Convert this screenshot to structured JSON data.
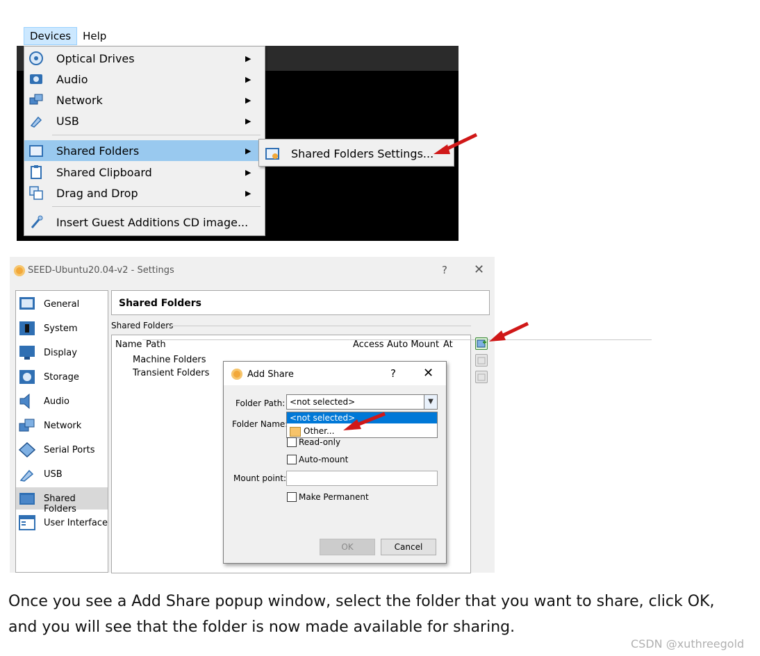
{
  "menubar": {
    "items": [
      {
        "label": "Devices"
      },
      {
        "label": "Help"
      }
    ]
  },
  "devices_menu": {
    "items": [
      {
        "label": "Optical Drives",
        "icon": "disc-icon"
      },
      {
        "label": "Audio",
        "icon": "audio-icon"
      },
      {
        "label": "Network",
        "icon": "network-icon"
      },
      {
        "label": "USB",
        "icon": "usb-icon"
      },
      {
        "label": "Shared Folders",
        "icon": "folder-icon"
      },
      {
        "label": "Shared Clipboard",
        "icon": "clipboard-icon"
      },
      {
        "label": "Drag and Drop",
        "icon": "drag-drop-icon"
      },
      {
        "label": "Insert Guest Additions CD image...",
        "icon": "guest-additions-icon"
      }
    ],
    "submenu_item": "Shared Folders Settings..."
  },
  "settings_window": {
    "title": "SEED-Ubuntu20.04-v2 - Settings",
    "help": "?",
    "close": "✕",
    "categories": [
      {
        "label": "General"
      },
      {
        "label": "System"
      },
      {
        "label": "Display"
      },
      {
        "label": "Storage"
      },
      {
        "label": "Audio"
      },
      {
        "label": "Network"
      },
      {
        "label": "Serial Ports"
      },
      {
        "label": "USB"
      },
      {
        "label": "Shared Folders"
      },
      {
        "label": "User Interface"
      }
    ],
    "panel_title": "Shared Folders",
    "group_label": "Shared Folders",
    "columns": [
      "Name",
      "Path",
      "Access",
      "Auto Mount",
      "At"
    ],
    "tree_nodes": [
      "Machine Folders",
      "Transient Folders"
    ]
  },
  "add_share": {
    "title": "Add Share",
    "help": "?",
    "close": "✕",
    "folder_path_label": "Folder Path:",
    "folder_path_value": "<not selected>",
    "dropdown_options": [
      "<not selected>",
      "Other..."
    ],
    "folder_name_label": "Folder Name:",
    "read_only_label": "Read-only",
    "auto_mount_label": "Auto-mount",
    "mount_point_label": "Mount point:",
    "make_permanent_label": "Make Permanent",
    "ok_label": "OK",
    "cancel_label": "Cancel"
  },
  "caption": "Once you see a Add Share popup window, select the folder that you want to share, click OK, and you will see that the folder is now made available for sharing.",
  "watermark": "CSDN @xuthreegold",
  "colors": {
    "highlight": "#99c9ef",
    "selection": "#0078d7",
    "arrow": "#d01818"
  }
}
